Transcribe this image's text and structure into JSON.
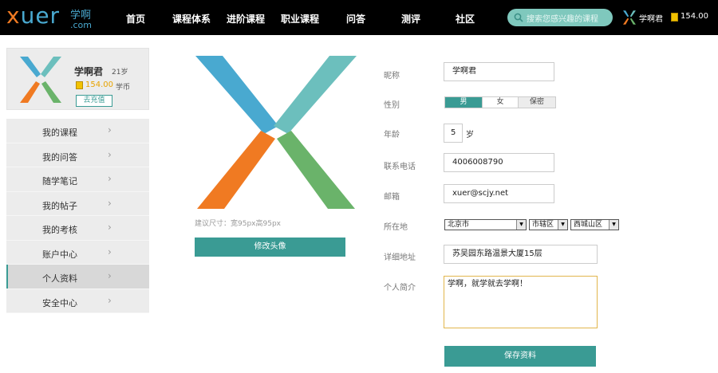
{
  "brand": {
    "logo_x": "x",
    "logo_rest": "uer",
    "logo_cn": "学啊",
    "logo_domain": ".com",
    "colors": {
      "teal": "#3a9b94",
      "blue": "#49a9d0",
      "orange": "#f07a22",
      "green": "#6ab36a",
      "aqua": "#6cbfbd"
    }
  },
  "nav": {
    "items": [
      "首页",
      "课程体系",
      "进阶课程",
      "职业课程",
      "问答",
      "测评",
      "社区"
    ]
  },
  "search": {
    "placeholder": "搜索您感兴趣的课程"
  },
  "topbar_user": {
    "name": "学啊君",
    "coins": "154.00",
    "coin_icon": "gold-coin-icon"
  },
  "profile": {
    "name": "学啊君",
    "age": "21岁",
    "coins": "154.00",
    "coin_label": "学币",
    "recharge_label": "去充值"
  },
  "menu": {
    "items": [
      {
        "label": "我的课程"
      },
      {
        "label": "我的问答"
      },
      {
        "label": "随学笔记"
      },
      {
        "label": "我的帖子"
      },
      {
        "label": "我的考核"
      },
      {
        "label": "账户中心"
      },
      {
        "label": "个人资料"
      },
      {
        "label": "安全中心"
      }
    ],
    "active_index": 6,
    "chevron": "›"
  },
  "avatar_section": {
    "size_hint": "建议尺寸：宽95px高95px",
    "change_button": "修改头像"
  },
  "form": {
    "nickname": {
      "label": "昵称",
      "value": "学啊君"
    },
    "gender": {
      "label": "性别",
      "options": [
        "男",
        "女",
        "保密"
      ],
      "selected": "男"
    },
    "age": {
      "label": "年龄",
      "value": "5",
      "unit": "岁"
    },
    "phone": {
      "label": "联系电话",
      "value": "4006008790"
    },
    "email": {
      "label": "邮箱",
      "value": "xuer@scjy.net"
    },
    "location": {
      "label": "所在地",
      "province": "北京市",
      "city": "市辖区",
      "district": "西城山区"
    },
    "address": {
      "label": "详细地址",
      "value": "苏吴园东路温景大厦15层"
    },
    "bio": {
      "label": "个人简介",
      "value": "学啊，就学就去学啊！"
    },
    "save_button": "保存资料"
  }
}
